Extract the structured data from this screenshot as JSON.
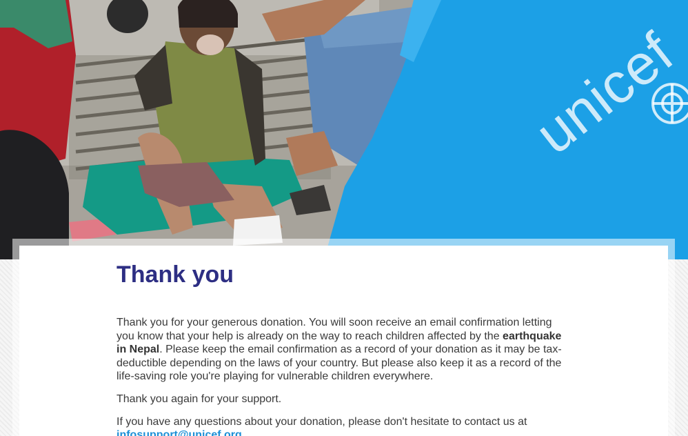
{
  "hero": {
    "image_description_icon": "photo-hero",
    "brand_text": "unicef"
  },
  "main": {
    "title": "Thank you",
    "paragraph1": {
      "before_strong": "Thank you for your generous donation. You will soon receive an email confirmation letting you know that your help is already on the way to reach children affected by the ",
      "strong": "earthquake in Nepal",
      "after_strong": ". Please keep the email confirmation as a record of your donation as it may be tax-deductible depending on the laws of your country. But please also keep it as a record of the life-saving role you're playing for vulnerable children everywhere."
    },
    "paragraph2": "Thank you again for your support.",
    "paragraph3": {
      "text": "If you have any questions about your donation, please don't hesitate to contact us at ",
      "email": "infosupport@unicef.org",
      "trailing": "."
    }
  },
  "colors": {
    "title": "#2d2e83",
    "link": "#1c8fd6",
    "unicef_blue": "#1ca0e6"
  }
}
